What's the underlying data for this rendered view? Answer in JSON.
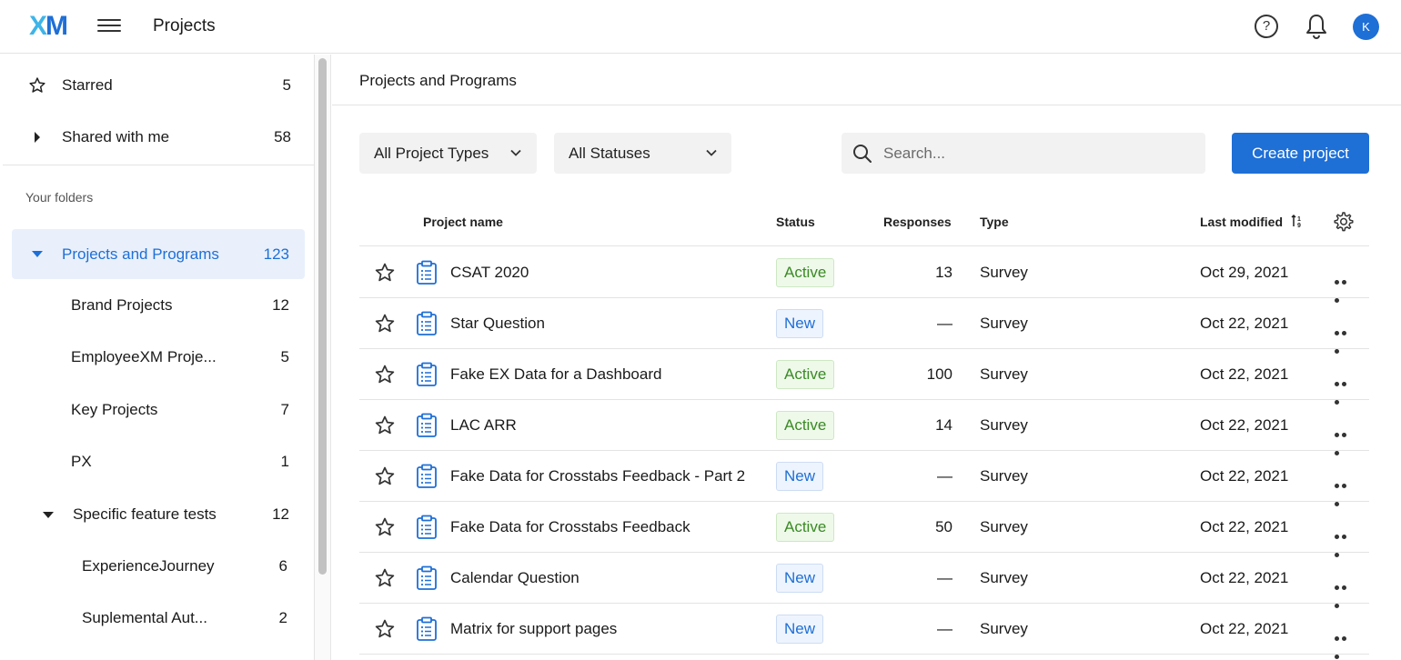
{
  "header": {
    "logo_x": "X",
    "logo_m": "M",
    "title": "Projects",
    "help_label": "?",
    "avatar_initial": "K"
  },
  "sidebar": {
    "top_items": [
      {
        "label": "Starred",
        "count": "5",
        "icon": "star-icon"
      },
      {
        "label": "Shared with me",
        "count": "58",
        "icon": "caret-right-icon"
      }
    ],
    "folders_heading": "Your folders",
    "folders": [
      {
        "label": "Projects and Programs",
        "count": "123",
        "active": true
      },
      {
        "label": "Brand Projects",
        "count": "12"
      },
      {
        "label": "EmployeeXM Proje...",
        "count": "5"
      },
      {
        "label": "Key Projects",
        "count": "7"
      },
      {
        "label": "PX",
        "count": "1"
      },
      {
        "label": "Specific feature tests",
        "count": "12"
      },
      {
        "label": "ExperienceJourney",
        "count": "6"
      },
      {
        "label": "Suplemental Aut...",
        "count": "2"
      }
    ]
  },
  "main": {
    "title": "Projects and Programs",
    "filters": {
      "project_types": "All Project Types",
      "statuses": "All Statuses"
    },
    "search": {
      "placeholder": "Search..."
    },
    "create_label": "Create project",
    "columns": {
      "name": "Project name",
      "status": "Status",
      "responses": "Responses",
      "type": "Type",
      "modified": "Last modified"
    },
    "rows": [
      {
        "name": "CSAT 2020",
        "status": "Active",
        "responses": "13",
        "type": "Survey",
        "modified": "Oct 29, 2021"
      },
      {
        "name": "Star Question",
        "status": "New",
        "responses": "—",
        "type": "Survey",
        "modified": "Oct 22, 2021"
      },
      {
        "name": "Fake EX Data for a Dashboard",
        "status": "Active",
        "responses": "100",
        "type": "Survey",
        "modified": "Oct 22, 2021"
      },
      {
        "name": "LAC ARR",
        "status": "Active",
        "responses": "14",
        "type": "Survey",
        "modified": "Oct 22, 2021"
      },
      {
        "name": "Fake Data for Crosstabs Feedback - Part 2",
        "status": "New",
        "responses": "—",
        "type": "Survey",
        "modified": "Oct 22, 2021"
      },
      {
        "name": "Fake Data for Crosstabs Feedback",
        "status": "Active",
        "responses": "50",
        "type": "Survey",
        "modified": "Oct 22, 2021"
      },
      {
        "name": "Calendar Question",
        "status": "New",
        "responses": "—",
        "type": "Survey",
        "modified": "Oct 22, 2021"
      },
      {
        "name": "Matrix for support pages",
        "status": "New",
        "responses": "—",
        "type": "Survey",
        "modified": "Oct 22, 2021"
      }
    ]
  },
  "colors": {
    "accent": "#1e6fd6",
    "logo_light": "#3fb4e8",
    "active_green": "#3a8a24",
    "selected_bg": "#e9f0fc"
  }
}
